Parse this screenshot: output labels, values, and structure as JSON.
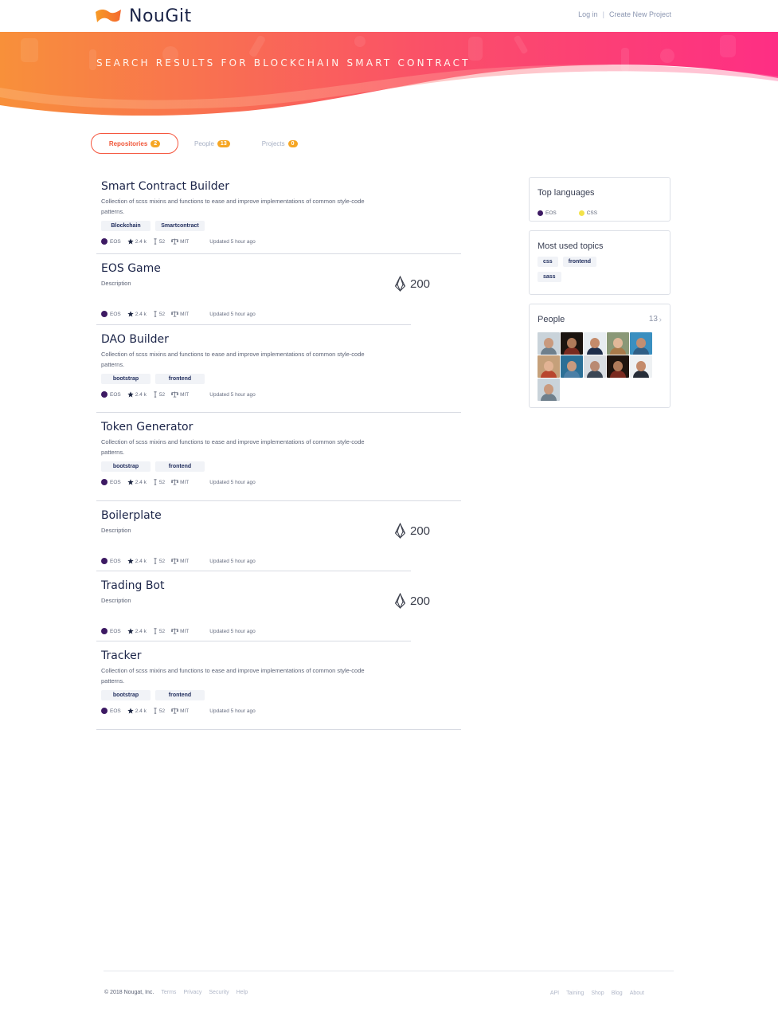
{
  "brand": {
    "name": "NouGit",
    "logo_colors": [
      "#f79b26",
      "#f4692f"
    ]
  },
  "header": {
    "login": "Log in",
    "separator": "|",
    "create_project": "Create New Project"
  },
  "hero": {
    "title": "SEARCH RESULTS FOR BLOCKCHAIN SMART CONTRACT",
    "gradient": [
      "#f89036",
      "#fa4a6e",
      "#fd2f84"
    ]
  },
  "tabs": [
    {
      "label": "Repositories",
      "count": "2",
      "active": true
    },
    {
      "label": "People",
      "count": "13",
      "active": false
    },
    {
      "label": "Projects",
      "count": "0",
      "active": false
    }
  ],
  "results": [
    {
      "title": "Smart Contract Builder",
      "description": "Collection of scss mixins and functions to ease and improve implementations of common style-code patterns.",
      "tags": [
        "Blockchain",
        "Smartcontract"
      ],
      "language": "EOS",
      "stars": "2.4 k",
      "forks": "52",
      "license": "MIT",
      "updated": "Updated 5 hour ago"
    },
    {
      "title": "EOS Game",
      "description": "Description",
      "reward": "200",
      "language": "EOS",
      "stars": "2.4 k",
      "forks": "52",
      "license": "MIT",
      "updated": "Updated 5 hour ago"
    },
    {
      "title": "DAO Builder",
      "description": "Collection of scss mixins and functions to ease and improve implementations of common style-code patterns.",
      "tags": [
        "bootstrap",
        "frontend"
      ],
      "language": "EOS",
      "stars": "2.4 k",
      "forks": "52",
      "license": "MIT",
      "updated": "Updated 5 hour ago"
    },
    {
      "title": "Token Generator",
      "description": "Collection of scss mixins and functions to ease and improve implementations of common style-code patterns.",
      "tags": [
        "bootstrap",
        "frontend"
      ],
      "language": "EOS",
      "stars": "2.4 k",
      "forks": "52",
      "license": "MIT",
      "updated": "Updated 5 hour ago"
    },
    {
      "title": "Boilerplate",
      "description": "Description",
      "reward": "200",
      "language": "EOS",
      "stars": "2.4 k",
      "forks": "52",
      "license": "MIT",
      "updated": "Updated 5 hour ago"
    },
    {
      "title": "Trading Bot",
      "description": "Description",
      "reward": "200",
      "language": "EOS",
      "stars": "2.4 k",
      "forks": "52",
      "license": "MIT",
      "updated": "Updated 5 hour ago"
    },
    {
      "title": "Tracker",
      "description": "Collection of scss mixins and functions to ease and improve implementations of common style-code patterns.",
      "tags": [
        "bootstrap",
        "frontend"
      ],
      "language": "EOS",
      "stars": "2.4 k",
      "forks": "52",
      "license": "MIT",
      "updated": "Updated 5 hour ago"
    }
  ],
  "sidebar": {
    "languages": {
      "title": "Top languages",
      "items": [
        {
          "name": "EOS",
          "color": "#3d1a63"
        },
        {
          "name": "CSS",
          "color": "#f3e24a"
        }
      ]
    },
    "topics": {
      "title": "Most used topics",
      "items": [
        "css",
        "frontend",
        "sass"
      ]
    },
    "people": {
      "title": "People",
      "count": "13",
      "avatars": [
        {
          "bg": "#c9d3da",
          "skin": "#c99a7e",
          "shirt": "#6e7f8c"
        },
        {
          "bg": "#1b1410",
          "skin": "#b07b5a",
          "shirt": "#7a2a1f"
        },
        {
          "bg": "#e8edf1",
          "skin": "#c48b6b",
          "shirt": "#1d2d4a"
        },
        {
          "bg": "#8a9877",
          "skin": "#e1b899",
          "shirt": "#a87a4b"
        },
        {
          "bg": "#3a8fc0",
          "skin": "#c18e72",
          "shirt": "#2f5e85"
        },
        {
          "bg": "#c5a07a",
          "skin": "#e2b394",
          "shirt": "#b8462e"
        },
        {
          "bg": "#2b6f96",
          "skin": "#c99a7e",
          "shirt": "#4b7fa6"
        },
        {
          "bg": "#d8dde2",
          "skin": "#b98a72",
          "shirt": "#3a4654"
        },
        {
          "bg": "#20150f",
          "skin": "#b07b5a",
          "shirt": "#7a2a1f"
        },
        {
          "bg": "#eef1f3",
          "skin": "#c48b6b",
          "shirt": "#262d38"
        },
        {
          "bg": "#c9d3da",
          "skin": "#c99a7e",
          "shirt": "#6e7f8c"
        }
      ]
    }
  },
  "footer": {
    "copyright": "© 2018 Nougat, Inc.",
    "left_links": [
      "Terms",
      "Privacy",
      "Security",
      "Help"
    ],
    "right_links": [
      "API",
      "Taining",
      "Shop",
      "Blog",
      "About"
    ]
  }
}
